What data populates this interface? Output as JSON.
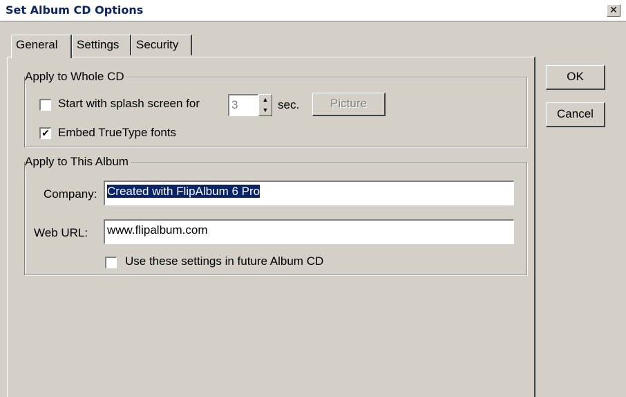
{
  "window": {
    "title": "Set Album CD Options",
    "close_glyph": "✕"
  },
  "tabs": [
    {
      "label": "General",
      "active": true
    },
    {
      "label": "Settings",
      "active": false
    },
    {
      "label": "Security",
      "active": false
    }
  ],
  "whole_cd": {
    "group_label": "Apply to Whole CD",
    "splash_label": "Start with splash screen for",
    "splash_checked": false,
    "splash_seconds": "3",
    "sec_label": "sec.",
    "picture_button": "Picture",
    "embed_fonts_label": "Embed TrueType fonts",
    "embed_fonts_checked": true
  },
  "this_album": {
    "group_label": "Apply to This Album",
    "company_label": "Company:",
    "company_value": "Created with FlipAlbum 6 Pro",
    "weburl_label": "Web URL:",
    "weburl_value": "www.flipalbum.com",
    "future_label": "Use these settings in future Album CD",
    "future_checked": false
  },
  "buttons": {
    "ok": "OK",
    "cancel": "Cancel"
  },
  "glyphs": {
    "check": "✔",
    "spin_up": "▲",
    "spin_down": "▼"
  }
}
